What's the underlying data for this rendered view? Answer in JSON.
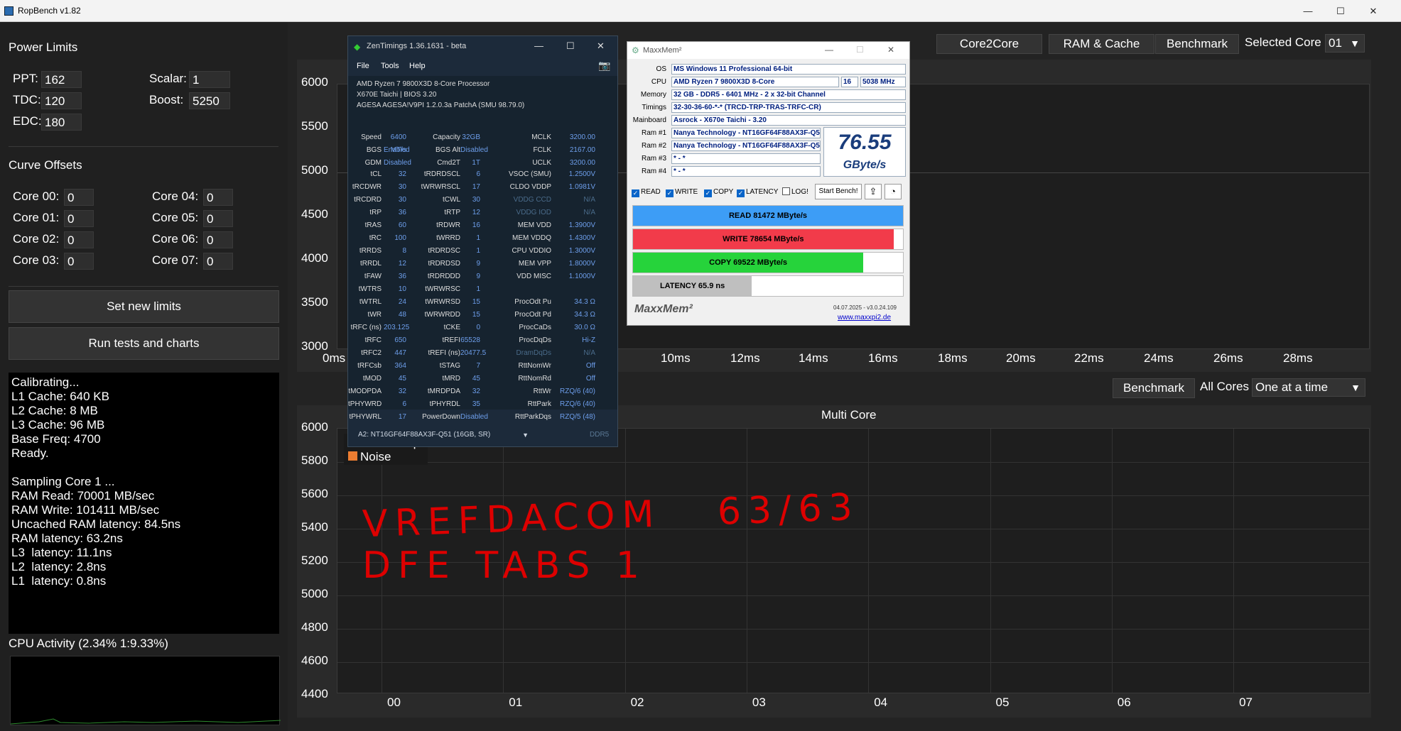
{
  "titlebar": {
    "title": "RopBench v1.82",
    "minimize": "—",
    "maximize": "☐",
    "close": "✕"
  },
  "power": {
    "heading": "Power Limits",
    "ppt_label": "PPT:",
    "ppt_value": "162",
    "tdc_label": "TDC:",
    "tdc_value": "120",
    "edc_label": "EDC:",
    "edc_value": "180",
    "scalar_label": "Scalar:",
    "scalar_value": "1",
    "boost_label": "Boost:",
    "boost_value": "5250"
  },
  "curve": {
    "heading": "Curve Offsets",
    "cores": [
      {
        "label": "Core 00:",
        "value": "0"
      },
      {
        "label": "Core 01:",
        "value": "0"
      },
      {
        "label": "Core 02:",
        "value": "0"
      },
      {
        "label": "Core 03:",
        "value": "0"
      },
      {
        "label": "Core 04:",
        "value": "0"
      },
      {
        "label": "Core 05:",
        "value": "0"
      },
      {
        "label": "Core 06:",
        "value": "0"
      },
      {
        "label": "Core 07:",
        "value": "0"
      }
    ]
  },
  "buttons": {
    "set_limits": "Set new limits",
    "run_tests": "Run tests and charts"
  },
  "console": [
    "Calibrating...",
    "L1 Cache: 640 KB",
    "L2 Cache: 8 MB",
    "L3 Cache: 96 MB",
    "Base Freq: 4700",
    "Ready.",
    "",
    "Sampling Core 1 ...",
    "RAM Read: 70001 MB/sec",
    "RAM Write: 101411 MB/sec",
    "Uncached RAM latency: 84.5ns",
    "RAM latency: 63.2ns",
    "L3  latency: 11.1ns",
    "L2  latency: 2.8ns",
    "L1  latency: 0.8ns"
  ],
  "cpu_activity": "CPU Activity (2.34% 1:9.33%)",
  "top_tabs": {
    "core2core": "Core2Core",
    "ram_cache": "RAM & Cache",
    "benchmark": "Benchmark",
    "selected_core_label": "Selected Core",
    "selected_core_value": "01"
  },
  "bench_controls": {
    "benchmark": "Benchmark",
    "all_cores": "All Cores",
    "mode": "One at a time"
  },
  "top_chart": {
    "y_ticks": [
      "6000",
      "5500",
      "5000",
      "4500",
      "4000",
      "3500",
      "3000"
    ],
    "x_ticks": [
      "0ms",
      "s",
      "10ms",
      "12ms",
      "14ms",
      "16ms",
      "18ms",
      "20ms",
      "22ms",
      "24ms",
      "26ms",
      "28ms"
    ]
  },
  "multi_chart": {
    "title": "Multi Core",
    "y_ticks": [
      "6000",
      "5800",
      "5600",
      "5400",
      "5200",
      "5000",
      "4800",
      "4600",
      "4400"
    ],
    "x_ticks": [
      "00",
      "01",
      "02",
      "03",
      "04",
      "05",
      "06",
      "07"
    ],
    "legend": [
      {
        "label": "Peak Freqs",
        "color": "#4472c4"
      },
      {
        "label": "Noise",
        "color": "#ed7d31"
      }
    ],
    "handwriting": {
      "line1": "VREFDACOM   63/63",
      "line2": "DFE TABS 1"
    }
  },
  "zentimings": {
    "title": "ZenTimings 1.36.1631 - beta",
    "menu": [
      "File",
      "Tools",
      "Help"
    ],
    "info": [
      "AMD Ryzen 7 9800X3D 8-Core Processor",
      "X670E Taichi | BIOS 3.20",
      "AGESA AGESA!V9PI 1.2.0.3a PatchA (SMU 98.79.0)"
    ],
    "top_rows": [
      [
        "Speed",
        "6400 MT/s",
        "Capacity",
        "32GB",
        "MCLK",
        "3200.00"
      ],
      [
        "BGS",
        "Enabled",
        "BGS Alt",
        "Disabled",
        "FCLK",
        "2167.00"
      ],
      [
        "GDM",
        "Disabled",
        "Cmd2T",
        "1T",
        "UCLK",
        "3200.00"
      ]
    ],
    "rows": [
      [
        "tCL",
        "32",
        "tRDRDSCL",
        "6",
        "VSOC (SMU)",
        "1.2500V"
      ],
      [
        "tRCDWR",
        "30",
        "tWRWRSCL",
        "17",
        "CLDO VDDP",
        "1.0981V"
      ],
      [
        "tRCDRD",
        "30",
        "tCWL",
        "30",
        "VDDG CCD",
        "N/A"
      ],
      [
        "tRP",
        "36",
        "tRTP",
        "12",
        "VDDG IOD",
        "N/A"
      ],
      [
        "tRAS",
        "60",
        "tRDWR",
        "16",
        "MEM VDD",
        "1.3900V"
      ],
      [
        "tRC",
        "100",
        "tWRRD",
        "1",
        "MEM VDDQ",
        "1.4300V"
      ],
      [
        "tRRDS",
        "8",
        "tRDRDSC",
        "1",
        "CPU VDDIO",
        "1.3000V"
      ],
      [
        "tRRDL",
        "12",
        "tRDRDSD",
        "9",
        "MEM VPP",
        "1.8000V"
      ],
      [
        "tFAW",
        "36",
        "tRDRDDD",
        "9",
        "VDD MISC",
        "1.1000V"
      ],
      [
        "tWTRS",
        "10",
        "tWRWRSC",
        "1",
        "",
        ""
      ],
      [
        "tWTRL",
        "24",
        "tWRWRSD",
        "15",
        "ProcOdt Pu",
        "34.3 Ω"
      ],
      [
        "tWR",
        "48",
        "tWRWRDD",
        "15",
        "ProcOdt Pd",
        "34.3 Ω"
      ],
      [
        "tRFC (ns)",
        "203.125",
        "tCKE",
        "0",
        "ProcCaDs",
        "30.0 Ω"
      ],
      [
        "tRFC",
        "650",
        "tREFI",
        "65528",
        "ProcDqDs",
        "Hi-Z"
      ],
      [
        "tRFC2",
        "447",
        "tREFI (ns)",
        "20477.5",
        "DramDqDs",
        "N/A"
      ],
      [
        "tRFCsb",
        "364",
        "tSTAG",
        "7",
        "RttNomWr",
        "Off"
      ],
      [
        "tMOD",
        "45",
        "tMRD",
        "45",
        "RttNomRd",
        "Off"
      ],
      [
        "tMODPDA",
        "32",
        "tMRDPDA",
        "32",
        "RttWr",
        "RZQ/6 (40)"
      ],
      [
        "tPHYWRD",
        "6",
        "tPHYRDL",
        "35",
        "RttPark",
        "RZQ/6 (40)"
      ],
      [
        "tPHYWRL",
        "17",
        "PowerDown",
        "Disabled",
        "RttParkDqs",
        "RZQ/5 (48)"
      ]
    ],
    "footer_select": "A2: NT16GF64F88AX3F-Q51 (16GB, SR)",
    "footer_type": "DDR5"
  },
  "maxxmem": {
    "title": "MaxxMem²",
    "os_label": "OS",
    "os": "MS Windows 11 Professional 64-bit",
    "cpu_label": "CPU",
    "cpu": "AMD Ryzen 7 9800X3D 8-Core",
    "cpu_threads": "16",
    "cpu_mhz": "5038 MHz",
    "memory_label": "Memory",
    "memory": "32 GB - DDR5 - 6401 MHz - 2 x 32-bit Channel",
    "timings_label": "Timings",
    "timings": "32-30-36-60-*-* (TRCD-TRP-TRAS-TRFC-CR)",
    "mainboard_label": "Mainboard",
    "mainboard": "Asrock - X670e Taichi - 3.20",
    "ram1_label": "Ram #1",
    "ram1": "Nanya Technology - NT16GF64F88AX3F-Q51",
    "ram2_label": "Ram #2",
    "ram2": "Nanya Technology - NT16GF64F88AX3F-Q51",
    "ram3_label": "Ram #3",
    "ram3": "* - *",
    "ram4_label": "Ram #4",
    "ram4": "* - *",
    "score": "76.55",
    "score_unit": "GByte/s",
    "checks": [
      {
        "label": "READ",
        "on": true
      },
      {
        "label": "WRITE",
        "on": true
      },
      {
        "label": "COPY",
        "on": true
      },
      {
        "label": "LATENCY",
        "on": true
      },
      {
        "label": "LOG!",
        "on": false
      }
    ],
    "start": "Start Bench!",
    "bars": [
      {
        "label": "READ  81472  MByte/s",
        "fraction": 1.0,
        "color": "#3d9df6"
      },
      {
        "label": "WRITE  78654  MByte/s",
        "fraction": 0.965,
        "color": "#f23b4a"
      },
      {
        "label": "COPY  69522  MByte/s",
        "fraction": 0.853,
        "color": "#26d33b"
      },
      {
        "label": "LATENCY  65.9  ns",
        "fraction": 0.44,
        "color": "#bfbfbf"
      }
    ],
    "logo": "MaxxMem²",
    "version": "04.07.2025 - v3.0.24.109",
    "link": "www.maxxpi2.de"
  }
}
